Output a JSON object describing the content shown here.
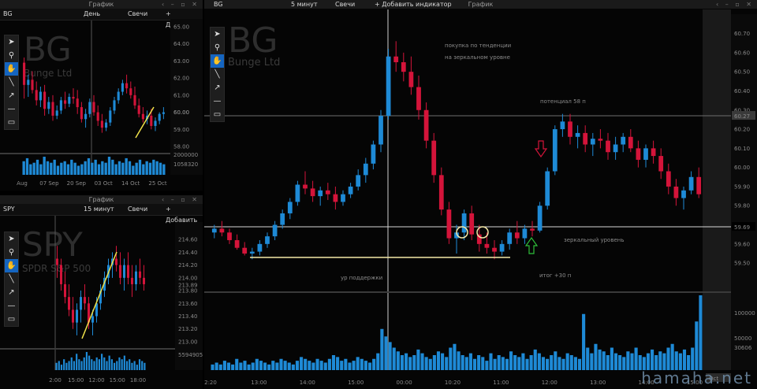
{
  "panels": {
    "top_left": {
      "window_title": "График",
      "symbol": "BG",
      "interval": "День",
      "type": "Свечи",
      "add_label": "+ Добавить",
      "big_symbol": "BG",
      "company": "Bunge Ltd"
    },
    "bottom_left": {
      "window_title": "График",
      "symbol": "SPY",
      "interval": "15 минут",
      "type": "Свечи",
      "add_label": "+ Добавить",
      "big_symbol": "SPY",
      "company": "SPDR S&P 500"
    },
    "main": {
      "window_title": "График",
      "symbol": "BG",
      "interval": "5 минут",
      "type": "Свечи",
      "add_label": "+ Добавить индикатор",
      "big_symbol": "BG",
      "company": "Bunge Ltd",
      "annotations": {
        "title_line1": "покупка по тенденции",
        "title_line2": "на зеркальном уровне",
        "potential": "потенциал 58 п",
        "mirror": "зеркальный уровень",
        "support": "ур поддержки",
        "result": "итог +30 п"
      },
      "last_price": "60.27",
      "mirror_price": "59.69",
      "vol_date": "Oct"
    }
  },
  "watermark": "hamaha.net",
  "colors": {
    "up": "#1e8ad6",
    "down": "#d4143a",
    "yellow": "#f0e24a",
    "support_line": "#f5e9a8",
    "potential_text": "#5cb6d6",
    "mirror_text": "#2fbf3a",
    "volume": "#1e8ad6"
  },
  "chart_data": [
    {
      "id": "bg_daily",
      "type": "candlestick",
      "ylim": [
        58.0,
        65.0
      ],
      "y_ticks": [
        "65.00",
        "64.00",
        "63.00",
        "62.00",
        "61.00",
        "60.00",
        "59.00",
        "58.00"
      ],
      "x_ticks": [
        "Aug",
        "07 Sep",
        "20 Sep",
        "03 Oct",
        "14 Oct",
        "25 Oct"
      ],
      "last_price": "60.00",
      "volume_ticks": [
        "2000000",
        "1058320"
      ],
      "volume": [
        9,
        11,
        7,
        8,
        10,
        7,
        12,
        9,
        8,
        10,
        6,
        8,
        9,
        7,
        10,
        8,
        6,
        7,
        9,
        11,
        8,
        10,
        7,
        9,
        8,
        12,
        10,
        7,
        9,
        8,
        11,
        9,
        6,
        8,
        10,
        7,
        9,
        8,
        10,
        9,
        8,
        7
      ],
      "candles": [
        [
          62.9,
          63.2,
          60.8,
          61.6
        ],
        [
          61.6,
          62.2,
          60.9,
          61.9
        ],
        [
          61.9,
          62.4,
          61.1,
          61.3
        ],
        [
          61.3,
          61.8,
          60.4,
          60.7
        ],
        [
          60.7,
          61.5,
          60.3,
          61.2
        ],
        [
          61.2,
          61.6,
          59.8,
          60.2
        ],
        [
          60.2,
          60.9,
          59.9,
          60.6
        ],
        [
          60.6,
          61.0,
          59.5,
          59.8
        ],
        [
          59.8,
          60.4,
          59.6,
          60.1
        ],
        [
          60.1,
          60.9,
          59.9,
          60.7
        ],
        [
          60.7,
          61.2,
          60.2,
          60.5
        ],
        [
          60.5,
          61.1,
          60.3,
          60.9
        ],
        [
          60.9,
          61.4,
          60.5,
          60.8
        ],
        [
          60.8,
          61.3,
          59.9,
          60.3
        ],
        [
          60.3,
          60.6,
          59.4,
          59.6
        ],
        [
          59.6,
          60.2,
          59.1,
          59.9
        ],
        [
          59.9,
          60.8,
          59.7,
          60.6
        ],
        [
          60.6,
          61.0,
          59.8,
          60.0
        ],
        [
          60.0,
          60.4,
          59.2,
          59.5
        ],
        [
          59.5,
          59.9,
          58.8,
          59.1
        ],
        [
          59.1,
          59.6,
          58.9,
          59.4
        ],
        [
          59.4,
          60.3,
          59.2,
          60.1
        ],
        [
          60.1,
          60.9,
          59.9,
          60.7
        ],
        [
          60.7,
          61.4,
          60.5,
          61.2
        ],
        [
          61.2,
          61.9,
          61.0,
          61.7
        ],
        [
          61.7,
          62.2,
          61.1,
          61.4
        ],
        [
          61.4,
          61.8,
          60.8,
          61.0
        ],
        [
          61.0,
          61.5,
          60.2,
          60.4
        ],
        [
          60.4,
          60.8,
          59.7,
          59.9
        ],
        [
          59.9,
          60.3,
          59.4,
          59.6
        ],
        [
          59.6,
          60.1,
          59.3,
          59.8
        ],
        [
          59.8,
          60.2,
          59.0,
          59.2
        ],
        [
          59.2,
          59.7,
          58.9,
          59.5
        ],
        [
          59.5,
          60.0,
          59.3,
          59.9
        ],
        [
          59.9,
          60.3,
          59.6,
          60.0
        ]
      ]
    },
    {
      "id": "spy_15m",
      "type": "candlestick",
      "ylim": [
        212.95,
        214.75
      ],
      "y_ticks": [
        "214.60",
        "214.40",
        "214.20",
        "214.00",
        "213.80",
        "213.60",
        "213.40",
        "213.20",
        "213.00"
      ],
      "x_ticks": [
        "2:00",
        "15:00",
        "12:00",
        "15:00",
        "18:00"
      ],
      "last_price": "213.89",
      "volume_ticks": [
        "5594905"
      ],
      "volume": [
        4,
        5,
        3,
        6,
        4,
        5,
        7,
        5,
        9,
        6,
        5,
        7,
        10,
        8,
        6,
        5,
        7,
        6,
        9,
        7,
        5,
        8,
        6,
        4,
        5,
        7,
        6,
        8,
        5,
        6,
        4,
        5,
        3,
        6,
        5,
        4
      ],
      "candles": [
        [
          214.3,
          214.5,
          214.0,
          214.2
        ],
        [
          214.2,
          214.3,
          213.8,
          213.9
        ],
        [
          213.9,
          214.1,
          213.6,
          213.7
        ],
        [
          213.7,
          213.9,
          213.4,
          213.5
        ],
        [
          213.5,
          213.7,
          213.2,
          213.3
        ],
        [
          213.3,
          213.6,
          213.1,
          213.5
        ],
        [
          213.5,
          213.8,
          213.3,
          213.7
        ],
        [
          213.7,
          213.9,
          213.5,
          213.6
        ],
        [
          213.6,
          213.7,
          213.2,
          213.3
        ],
        [
          213.3,
          213.5,
          213.1,
          213.4
        ],
        [
          213.4,
          213.7,
          213.3,
          213.6
        ],
        [
          213.6,
          213.9,
          213.5,
          213.8
        ],
        [
          213.8,
          214.1,
          213.7,
          214.0
        ],
        [
          214.0,
          214.3,
          213.9,
          214.2
        ],
        [
          214.2,
          214.4,
          214.0,
          214.3
        ],
        [
          214.3,
          214.5,
          214.1,
          214.2
        ],
        [
          214.2,
          214.4,
          213.9,
          214.0
        ],
        [
          214.0,
          214.3,
          213.8,
          214.2
        ],
        [
          214.2,
          214.4,
          213.9,
          214.0
        ],
        [
          214.0,
          214.2,
          213.7,
          213.9
        ],
        [
          213.9,
          214.2,
          213.8,
          214.1
        ],
        [
          214.1,
          214.3,
          213.9,
          214.0
        ],
        [
          214.0,
          214.2,
          213.8,
          213.9
        ]
      ]
    },
    {
      "id": "bg_5m",
      "type": "candlestick",
      "ylim": [
        59.41,
        60.76
      ],
      "y_ticks": [
        "60.70",
        "60.60",
        "60.50",
        "60.40",
        "60.30",
        "60.20",
        "60.10",
        "60.00",
        "59.90",
        "59.80",
        "59.70",
        "59.60",
        "59.50"
      ],
      "x_ticks": [
        "2:20",
        "13:00",
        "14:00",
        "15:00",
        "00:00",
        "10:20",
        "11:00",
        "12:00",
        "13:00",
        "14:00",
        "15:00"
      ],
      "marked_prices": {
        "potential": 60.27,
        "mirror": 59.69,
        "support": 59.53
      },
      "volume_ticks": [
        "100000",
        "50000",
        "30606"
      ],
      "volume": [
        3,
        4,
        3,
        5,
        4,
        3,
        6,
        4,
        5,
        3,
        4,
        6,
        5,
        4,
        3,
        5,
        4,
        6,
        5,
        4,
        3,
        5,
        7,
        6,
        5,
        4,
        6,
        5,
        4,
        6,
        8,
        7,
        5,
        6,
        4,
        5,
        7,
        6,
        5,
        4,
        6,
        9,
        22,
        18,
        15,
        12,
        10,
        8,
        9,
        7,
        8,
        11,
        9,
        7,
        6,
        8,
        10,
        9,
        7,
        12,
        14,
        10,
        8,
        7,
        9,
        6,
        8,
        7,
        5,
        9,
        6,
        8,
        7,
        6,
        10,
        8,
        7,
        9,
        6,
        8,
        11,
        9,
        7,
        6,
        8,
        10,
        7,
        6,
        9,
        8,
        7,
        6,
        30,
        12,
        9,
        14,
        11,
        10,
        8,
        12,
        9,
        8,
        7,
        10,
        9,
        12,
        8,
        7,
        9,
        11,
        8,
        10,
        9,
        12,
        14,
        10,
        9,
        11,
        8,
        12,
        26,
        40
      ],
      "candles": [
        [
          59.66,
          59.7,
          59.63,
          59.68
        ],
        [
          59.68,
          59.72,
          59.64,
          59.66
        ],
        [
          59.66,
          59.68,
          59.6,
          59.62
        ],
        [
          59.62,
          59.65,
          59.57,
          59.58
        ],
        [
          59.58,
          59.61,
          59.54,
          59.55
        ],
        [
          59.55,
          59.58,
          59.52,
          59.56
        ],
        [
          59.56,
          59.62,
          59.54,
          59.6
        ],
        [
          59.6,
          59.66,
          59.58,
          59.64
        ],
        [
          59.64,
          59.72,
          59.62,
          59.7
        ],
        [
          59.7,
          59.78,
          59.68,
          59.76
        ],
        [
          59.76,
          59.84,
          59.73,
          59.82
        ],
        [
          59.82,
          59.93,
          59.8,
          59.91
        ],
        [
          59.91,
          59.98,
          59.86,
          59.89
        ],
        [
          59.89,
          59.93,
          59.82,
          59.85
        ],
        [
          59.85,
          59.9,
          59.8,
          59.88
        ],
        [
          59.88,
          59.92,
          59.83,
          59.86
        ],
        [
          59.86,
          59.9,
          59.78,
          59.82
        ],
        [
          59.82,
          59.88,
          59.8,
          59.86
        ],
        [
          59.86,
          59.92,
          59.84,
          59.9
        ],
        [
          59.9,
          59.99,
          59.88,
          59.96
        ],
        [
          59.96,
          60.05,
          59.92,
          60.02
        ],
        [
          60.02,
          60.14,
          59.99,
          60.12
        ],
        [
          60.12,
          60.3,
          60.08,
          60.27
        ],
        [
          60.27,
          60.62,
          60.25,
          60.58
        ],
        [
          60.58,
          60.66,
          60.5,
          60.55
        ],
        [
          60.55,
          60.6,
          60.45,
          60.5
        ],
        [
          60.5,
          60.58,
          60.38,
          60.42
        ],
        [
          60.42,
          60.48,
          60.25,
          60.3
        ],
        [
          60.3,
          60.34,
          60.1,
          60.14
        ],
        [
          60.14,
          60.18,
          59.92,
          59.96
        ],
        [
          59.96,
          60.0,
          59.75,
          59.78
        ],
        [
          59.78,
          59.82,
          59.6,
          59.63
        ],
        [
          59.63,
          59.7,
          59.55,
          59.66
        ],
        [
          59.66,
          59.78,
          59.62,
          59.76
        ],
        [
          59.76,
          59.8,
          59.62,
          59.65
        ],
        [
          59.65,
          59.7,
          59.56,
          59.6
        ],
        [
          59.6,
          59.66,
          59.55,
          59.58
        ],
        [
          59.58,
          59.62,
          59.52,
          59.56
        ],
        [
          59.56,
          59.62,
          59.54,
          59.6
        ],
        [
          59.6,
          59.68,
          59.57,
          59.66
        ],
        [
          59.66,
          59.72,
          59.6,
          59.63
        ],
        [
          59.63,
          59.7,
          59.6,
          59.68
        ],
        [
          59.68,
          59.72,
          59.64,
          59.67
        ],
        [
          59.67,
          59.82,
          59.66,
          59.8
        ],
        [
          59.8,
          60.0,
          59.78,
          59.98
        ],
        [
          59.98,
          60.22,
          59.96,
          60.2
        ],
        [
          60.2,
          60.28,
          60.16,
          60.24
        ],
        [
          60.24,
          60.28,
          60.12,
          60.16
        ],
        [
          60.16,
          60.22,
          60.1,
          60.18
        ],
        [
          60.18,
          60.22,
          60.08,
          60.12
        ],
        [
          60.12,
          60.18,
          60.06,
          60.15
        ],
        [
          60.15,
          60.2,
          60.1,
          60.14
        ],
        [
          60.14,
          60.18,
          60.04,
          60.08
        ],
        [
          60.08,
          60.16,
          60.04,
          60.12
        ],
        [
          60.12,
          60.18,
          60.08,
          60.16
        ],
        [
          60.16,
          60.2,
          60.08,
          60.1
        ],
        [
          60.1,
          60.14,
          60.0,
          60.04
        ],
        [
          60.04,
          60.12,
          60.0,
          60.1
        ],
        [
          60.1,
          60.14,
          60.02,
          60.06
        ],
        [
          60.06,
          60.1,
          59.94,
          59.98
        ],
        [
          59.98,
          60.02,
          59.86,
          59.9
        ],
        [
          59.9,
          59.94,
          59.8,
          59.84
        ],
        [
          59.84,
          59.9,
          59.78,
          59.88
        ],
        [
          59.88,
          59.98,
          59.86,
          59.95
        ],
        [
          59.95,
          60.0,
          59.84,
          59.86
        ]
      ]
    }
  ]
}
